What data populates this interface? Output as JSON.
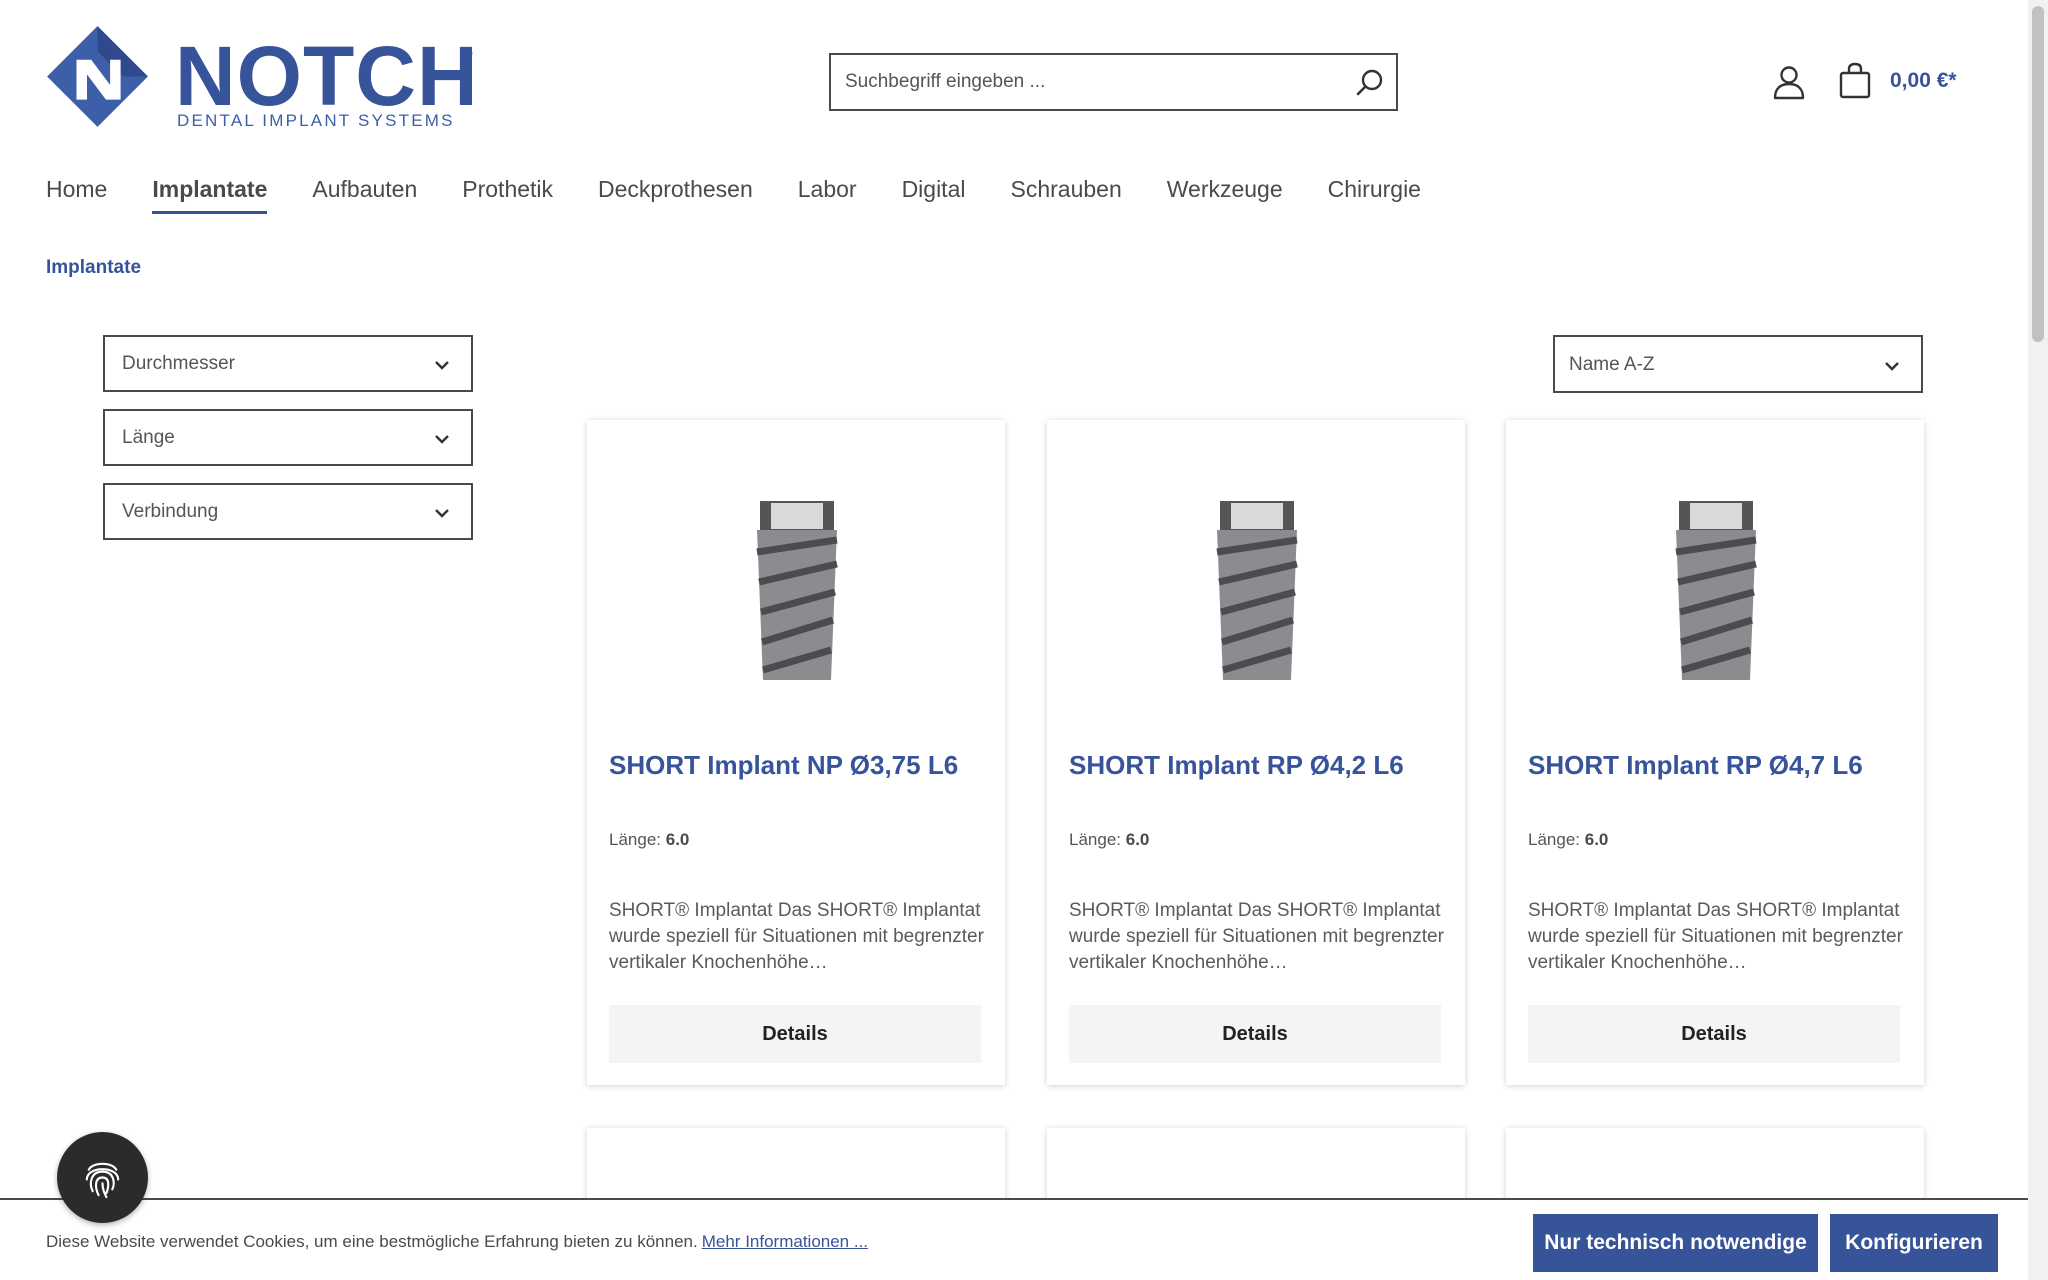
{
  "brand": {
    "name": "NOTCH",
    "registered": "®",
    "tagline": "DENTAL IMPLANT SYSTEMS",
    "primary_color": "#37539a"
  },
  "header": {
    "search": {
      "placeholder": "Suchbegriff eingeben ...",
      "value": ""
    },
    "cart_total": "0,00 €*",
    "icons": [
      "search-icon",
      "user-icon",
      "shopping-bag-icon"
    ]
  },
  "nav": {
    "items": [
      {
        "label": "Home"
      },
      {
        "label": "Implantate",
        "active": true
      },
      {
        "label": "Aufbauten"
      },
      {
        "label": "Prothetik"
      },
      {
        "label": "Deckprothesen"
      },
      {
        "label": "Labor"
      },
      {
        "label": "Digital"
      },
      {
        "label": "Schrauben"
      },
      {
        "label": "Werkzeuge"
      },
      {
        "label": "Chirurgie"
      }
    ]
  },
  "breadcrumb": "Implantate",
  "filters": [
    {
      "label": "Durchmesser"
    },
    {
      "label": "Länge"
    },
    {
      "label": "Verbindung"
    }
  ],
  "sort": {
    "selected": "Name A-Z"
  },
  "products": [
    {
      "title": "SHORT Implant NP Ø3,75 L6",
      "prop_label": "Länge:",
      "prop_value": "6.0",
      "description": "SHORT® Implantat Das SHORT® Implantat wurde speziell für Situationen mit begrenzter vertikaler Knochenhöhe…",
      "button": "Details"
    },
    {
      "title": "SHORT Implant RP Ø4,2 L6",
      "prop_label": "Länge:",
      "prop_value": "6.0",
      "description": "SHORT® Implantat Das SHORT® Implantat wurde speziell für Situationen mit begrenzter vertikaler Knochenhöhe…",
      "button": "Details"
    },
    {
      "title": "SHORT Implant RP Ø4,7 L6",
      "prop_label": "Länge:",
      "prop_value": "6.0",
      "description": "SHORT® Implantat Das SHORT® Implantat wurde speziell für Situationen mit begrenzter vertikaler Knochenhöhe…",
      "button": "Details"
    }
  ],
  "cookie": {
    "text": "Diese Website verwendet Cookies, um eine bestmögliche Erfahrung bieten zu können.",
    "link": "Mehr Informationen ...",
    "btn_necessary": "Nur technisch notwendige",
    "btn_configure": "Konfigurieren"
  }
}
